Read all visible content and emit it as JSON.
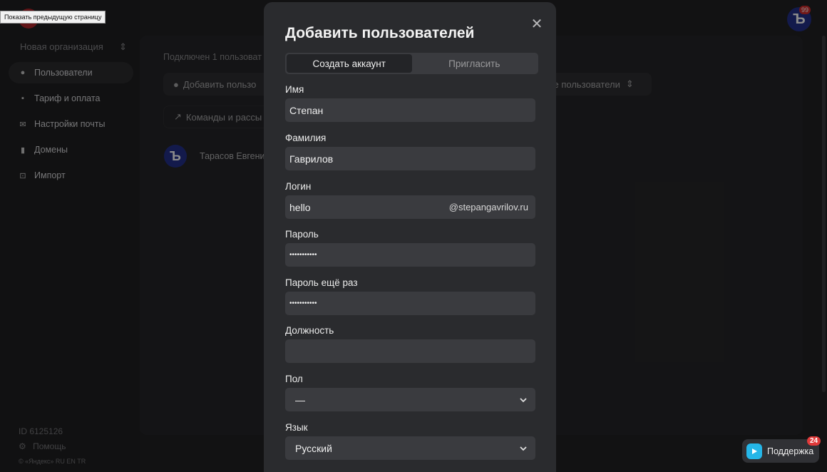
{
  "tooltip": "Показать предыдущую страницу",
  "sidebar": {
    "org_name": "Новая организация",
    "items": [
      {
        "label": "Пользователи"
      },
      {
        "label": "Тариф и оплата"
      },
      {
        "label": "Настройки почты"
      },
      {
        "label": "Домены"
      },
      {
        "label": "Импорт"
      }
    ],
    "id_text": "ID 6125126",
    "help": "Помощь",
    "footer": "© «Яндекс»   RU  EN  TR"
  },
  "content": {
    "connected": "Подключен 1 пользоват",
    "add_button": "Добавить пользо",
    "filter": "се пользователи",
    "teams": "Команды и рассы",
    "user_name": "Тарасов Евгени"
  },
  "header": {
    "avatar_letter": "Ъ",
    "badge": "99"
  },
  "modal": {
    "title": "Добавить пользователей",
    "tabs": [
      {
        "label": "Создать аккаунт"
      },
      {
        "label": "Пригласить"
      }
    ],
    "fields": {
      "first_name": {
        "label": "Имя",
        "value": "Степан"
      },
      "last_name": {
        "label": "Фамилия",
        "value": "Гаврилов"
      },
      "login": {
        "label": "Логин",
        "value": "hello",
        "domain": "@stepangavrilov.ru"
      },
      "password": {
        "label": "Пароль",
        "value": "•••••••••••"
      },
      "password_repeat": {
        "label": "Пароль ещё раз",
        "value": "•••••••••••"
      },
      "position": {
        "label": "Должность",
        "value": ""
      },
      "gender": {
        "label": "Пол",
        "value": "—"
      },
      "language": {
        "label": "Язык",
        "value": "Русский"
      }
    }
  },
  "support": {
    "label": "Поддержка",
    "badge": "24"
  },
  "colors": {
    "accent_blue": "#23308b",
    "badge_red": "#d22c2c",
    "support_icon": "#25b6e8"
  }
}
